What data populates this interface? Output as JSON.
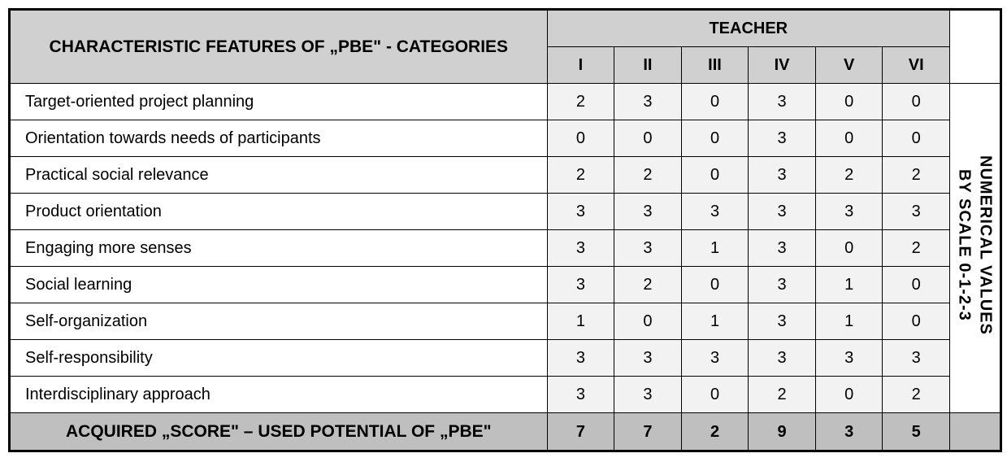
{
  "header": {
    "category_col": "CHARACTERISTIC FEATURES OF „PBE\" - CATEGORIES",
    "teacher": "TEACHER",
    "cols": [
      "I",
      "II",
      "III",
      "IV",
      "V",
      "VI"
    ]
  },
  "rows": [
    {
      "label": "Target-oriented project planning",
      "vals": [
        "2",
        "3",
        "0",
        "3",
        "0",
        "0"
      ]
    },
    {
      "label": "Orientation towards needs of participants",
      "vals": [
        "0",
        "0",
        "0",
        "3",
        "0",
        "0"
      ]
    },
    {
      "label": "Practical social relevance",
      "vals": [
        "2",
        "2",
        "0",
        "3",
        "2",
        "2"
      ]
    },
    {
      "label": "Product orientation",
      "vals": [
        "3",
        "3",
        "3",
        "3",
        "3",
        "3"
      ]
    },
    {
      "label": "Engaging more senses",
      "vals": [
        "3",
        "3",
        "1",
        "3",
        "0",
        "2"
      ]
    },
    {
      "label": "Social learning",
      "vals": [
        "3",
        "2",
        "0",
        "3",
        "1",
        "0"
      ]
    },
    {
      "label": "Self-organization",
      "vals": [
        "1",
        "0",
        "1",
        "3",
        "1",
        "0"
      ]
    },
    {
      "label": "Self-responsibility",
      "vals": [
        "3",
        "3",
        "3",
        "3",
        "3",
        "3"
      ]
    },
    {
      "label": "Interdisciplinary approach",
      "vals": [
        "3",
        "3",
        "0",
        "2",
        "0",
        "2"
      ]
    }
  ],
  "footer": {
    "label": "ACQUIRED „SCORE\" – USED POTENTIAL OF „PBE\"",
    "vals": [
      "7",
      "7",
      "2",
      "9",
      "3",
      "5"
    ]
  },
  "side": {
    "line1": "NUMERICAL VALUES",
    "line2": "BY SCALE 0-1-2-3"
  },
  "chart_data": {
    "type": "table",
    "title": "Characteristic features of PBE – categories, numerical values by scale 0-1-2-3",
    "columns": [
      "Category",
      "I",
      "II",
      "III",
      "IV",
      "V",
      "VI"
    ],
    "rows": [
      [
        "Target-oriented project planning",
        2,
        3,
        0,
        3,
        0,
        0
      ],
      [
        "Orientation towards needs of participants",
        0,
        0,
        0,
        3,
        0,
        0
      ],
      [
        "Practical social relevance",
        2,
        2,
        0,
        3,
        2,
        2
      ],
      [
        "Product orientation",
        3,
        3,
        3,
        3,
        3,
        3
      ],
      [
        "Engaging more senses",
        3,
        3,
        1,
        3,
        0,
        2
      ],
      [
        "Social learning",
        3,
        2,
        0,
        3,
        1,
        0
      ],
      [
        "Self-organization",
        1,
        0,
        1,
        3,
        1,
        0
      ],
      [
        "Self-responsibility",
        3,
        3,
        3,
        3,
        3,
        3
      ],
      [
        "Interdisciplinary approach",
        3,
        3,
        0,
        2,
        0,
        2
      ]
    ],
    "footer": [
      "Acquired score – used potential of PBE",
      7,
      7,
      2,
      9,
      3,
      5
    ]
  }
}
